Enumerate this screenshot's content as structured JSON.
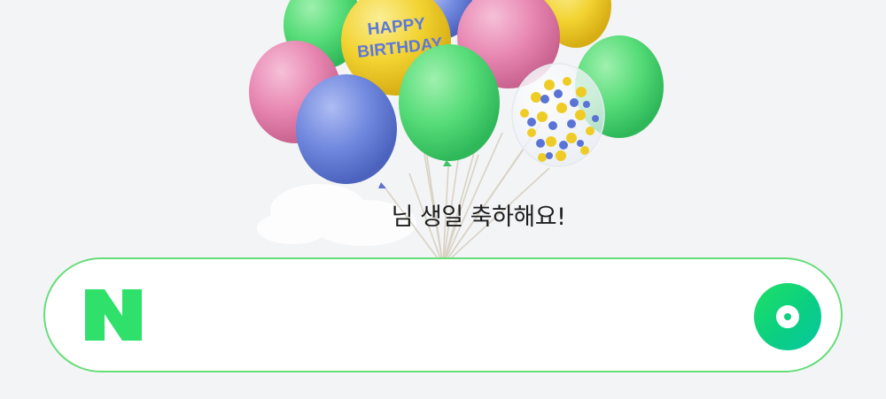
{
  "celebration": {
    "message": "님 생일 축하해요!",
    "balloon_text": [
      "HAPPY",
      "BIRTHDAY"
    ]
  },
  "search": {
    "logo_letter": "N",
    "value": "",
    "placeholder": "",
    "button_icon": "search-ring-icon"
  },
  "colors": {
    "brand_green": "#03c75a",
    "border_green": "#66dd7a",
    "balloon_green": "#55dc78",
    "balloon_pink": "#e987b1",
    "balloon_blue": "#6f86dc",
    "balloon_yellow": "#f1d232",
    "background": "#f3f4f6"
  }
}
